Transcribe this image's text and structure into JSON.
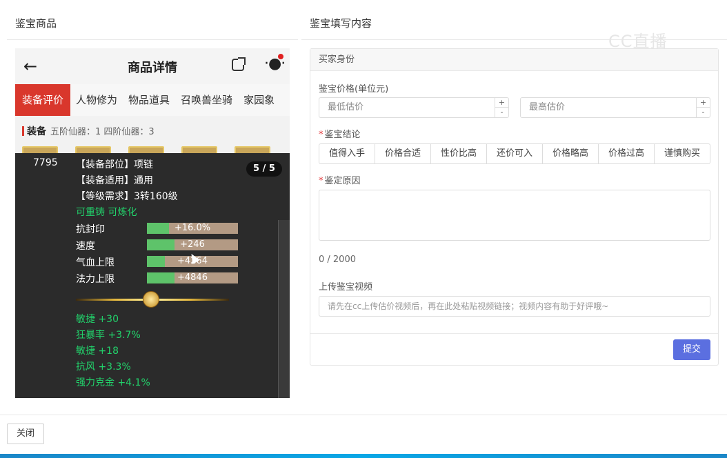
{
  "left_section": {
    "title": "鉴宝商品"
  },
  "right_section": {
    "title": "鉴宝填写内容"
  },
  "phone": {
    "header_title": "商品详情",
    "tabs": [
      "装备评价",
      "人物修为",
      "物品道具",
      "召唤兽坐骑",
      "家园象"
    ],
    "equip_label": "装备",
    "equip_sub": "五阶仙器：1  四阶仙器：3",
    "tooltip": {
      "id": "7795",
      "page": "5 / 5",
      "attrs": [
        "【装备部位】项链",
        "【装备适用】通用",
        "【等级需求】3转160级"
      ],
      "flags": "可重铸 可炼化",
      "stats": [
        {
          "label": "抗封印",
          "value": "+16.0%",
          "fill": 0.24
        },
        {
          "label": "速度",
          "value": "+246",
          "fill": 0.3
        },
        {
          "label": "气血上限",
          "value": "+4264",
          "fill": 0.2
        },
        {
          "label": "法力上限",
          "value": "+4846",
          "fill": 0.3
        }
      ],
      "extra": [
        "敏捷 +30",
        "狂暴率 +3.7%",
        "敏捷 +18",
        "抗风 +3.3%",
        "强力克金 +4.1%"
      ]
    }
  },
  "form": {
    "buyer_header": "买家身份",
    "price_label": "鉴宝价格(单位元)",
    "min_placeholder": "最低估价",
    "max_placeholder": "最高估价",
    "conclusion_label": "鉴宝结论",
    "conclusions": [
      "值得入手",
      "价格合适",
      "性价比高",
      "还价可入",
      "价格略高",
      "价格过高",
      "谨慎购买"
    ],
    "reason_label": "鉴定原因",
    "counter": "0 / 2000",
    "video_label": "上传鉴宝视频",
    "video_placeholder": "请先在cc上传估价视频后，再在此处粘贴视频链接；视频内容有助于好评哦~",
    "submit_label": "提交"
  },
  "watermark": "CC直播",
  "close_label": "关闭"
}
